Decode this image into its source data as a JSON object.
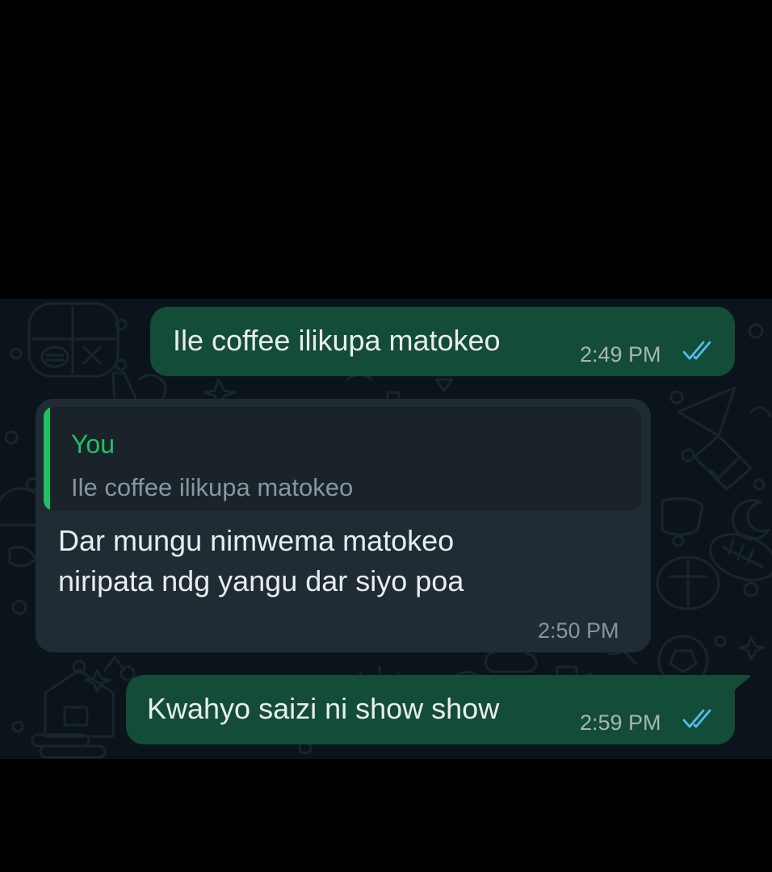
{
  "colors": {
    "outgoing_bubble": "#144d37",
    "incoming_bubble": "#1f2c34",
    "chat_background": "#0b141a",
    "quote_accent": "#21c063",
    "read_receipt": "#53bdeb"
  },
  "messages": [
    {
      "direction": "outgoing",
      "text": "Ile coffee ilikupa matokeo",
      "time": "2:49 PM",
      "status_icon": "double-check-read-icon"
    },
    {
      "direction": "incoming",
      "quote": {
        "author": "You",
        "text": "Ile coffee ilikupa matokeo"
      },
      "text_lines": [
        "Dar mungu nimwema matokeo",
        "niripata ndg yangu dar siyo poa"
      ],
      "time": "2:50 PM"
    },
    {
      "direction": "outgoing",
      "text": "Kwahyo saizi ni show show",
      "time": "2:59 PM",
      "status_icon": "double-check-read-icon"
    }
  ]
}
